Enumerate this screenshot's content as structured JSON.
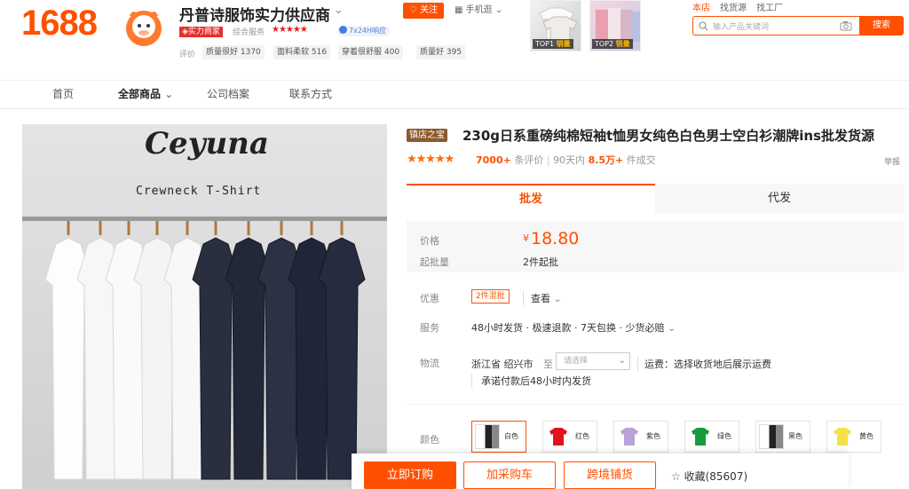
{
  "header": {
    "logo": "1688",
    "shop_name": "丹普诗服饰实力供应商",
    "follow": "关注",
    "mobile": "手机逛",
    "badge": "实力商家",
    "score_label": "综合服务",
    "stars": "★★★★★",
    "service_tag": "7x24H响应",
    "review_label": "评价",
    "review_tags": [
      "质量很好 1370",
      "面料柔软 516",
      "穿着很舒服 400",
      "质量好 395"
    ],
    "top_products": [
      {
        "rank": "TOP1",
        "label": "销量"
      },
      {
        "rank": "TOP2",
        "label": "销量"
      }
    ],
    "links": [
      "本店",
      "找货源",
      "找工厂"
    ],
    "search_placeholder": "输入产品关键词",
    "search_button": "搜索"
  },
  "nav": {
    "items": [
      "首页",
      "全部商品",
      "公司档案",
      "联系方式"
    ]
  },
  "product": {
    "image_brand": "Ceyuna",
    "image_subtitle": "Crewneck T-Shirt",
    "badge": "镇店之宝",
    "title": "230g日系重磅纯棉短袖t恤男女纯色白色男士空白衫潮牌ins批发货源",
    "rating_stars": "★★★★★",
    "review_count": "7000+",
    "review_suffix": "条评价",
    "sales_prefix": "90天内",
    "sales_count": "8.5万+",
    "sales_suffix": "件成交",
    "report": "举报"
  },
  "tabs": {
    "wholesale": "批发",
    "dropship": "代发"
  },
  "pricing": {
    "price_label": "价格",
    "currency": "¥",
    "price": "18.80",
    "moq_label": "起批量",
    "moq": "2件起批"
  },
  "details": {
    "promo_label": "优惠",
    "promo_tag": "2件混批",
    "promo_view": "查看",
    "service_label": "服务",
    "service_value": "48小时发货 · 极速退款 · 7天包换 · 少货必赔",
    "logistics_label": "物流",
    "origin": "浙江省 绍兴市",
    "to": "至",
    "select_placeholder": "请选择",
    "freight": "运费：选择收货地后展示运费",
    "ship_promise": "承诺付款后48小时内发货"
  },
  "colors": {
    "label": "颜色",
    "options": [
      {
        "name": "白色",
        "hex": "#ffffff"
      },
      {
        "name": "红色",
        "hex": "#e0141e"
      },
      {
        "name": "紫色",
        "hex": "#b8a2d8"
      },
      {
        "name": "绿色",
        "hex": "#1a9a3a"
      },
      {
        "name": "黑色",
        "hex": "#222222"
      },
      {
        "name": "黄色",
        "hex": "#f5e04a"
      }
    ]
  },
  "actions": {
    "order": "立即订购",
    "cart": "加采购车",
    "cross_border": "跨境铺货",
    "favorite": "收藏(85607)"
  },
  "theme": {
    "accent": "#ff5000"
  }
}
